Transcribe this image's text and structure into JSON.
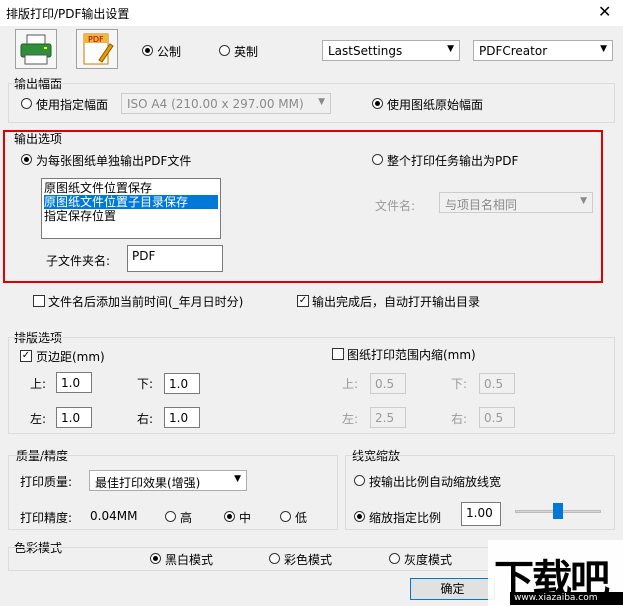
{
  "window": {
    "title": "排版打印/PDF输出设置",
    "close_glyph": "✕"
  },
  "toolbar": {
    "print_icon": "printer-icon",
    "pdf_icon": "pdf-icon",
    "pdf_icon_text": "PDF",
    "unit_metric": "公制",
    "unit_imperial": "英制",
    "settings_value": "LastSettings",
    "printer_value": "PDFCreator"
  },
  "output_size": {
    "title": "输出幅面",
    "use_specified": "使用指定幅面",
    "paper_value": "ISO A4 (210.00 x 297.00 MM)",
    "use_original": "使用图纸原始幅面"
  },
  "output_options": {
    "title": "输出选项",
    "per_sheet": "为每张图纸单独输出PDF文件",
    "whole_job": "整个打印任务输出为PDF",
    "locations": [
      "原图纸文件位置保存",
      "原图纸文件位置子目录保存",
      "指定保存位置"
    ],
    "subfolder_label": "子文件夹名:",
    "subfolder_value": "PDF",
    "filename_label": "文件名:",
    "filename_value": "与项目名相同",
    "add_time": "文件名后添加当前时间(_年月日时分)",
    "open_after": "输出完成后，自动打开输出目录"
  },
  "layout": {
    "title": "排版选项",
    "margin_label": "页边距(mm)",
    "top_label": "上:",
    "top_value": "1.0",
    "bottom_label": "下:",
    "bottom_value": "1.0",
    "left_label": "左:",
    "left_value": "1.0",
    "right_label": "右:",
    "right_value": "1.0",
    "shrink_label": "图纸打印范围内缩(mm)",
    "s_top_label": "上:",
    "s_top_value": "0.5",
    "s_bottom_label": "下:",
    "s_bottom_value": "0.5",
    "s_left_label": "左:",
    "s_left_value": "2.5",
    "s_right_label": "右:",
    "s_right_value": "0.5"
  },
  "quality": {
    "title": "质量/精度",
    "quality_label": "打印质量:",
    "quality_value": "最佳打印效果(增强)",
    "precision_label": "打印精度:",
    "precision_value": "0.04MM",
    "high": "高",
    "mid": "中",
    "low": "低"
  },
  "linewidth": {
    "title": "线宽缩放",
    "auto": "按输出比例自动缩放线宽",
    "specified": "缩放指定比例",
    "scale_value": "1.00",
    "slider_level": 0.5
  },
  "color_mode": {
    "title": "色彩模式",
    "bw": "黑白模式",
    "color": "彩色模式",
    "gray": "灰度模式"
  },
  "footer": {
    "ok": "确定"
  },
  "watermark": {
    "text": "下载吧",
    "url": "www.xiazaiba.com"
  }
}
